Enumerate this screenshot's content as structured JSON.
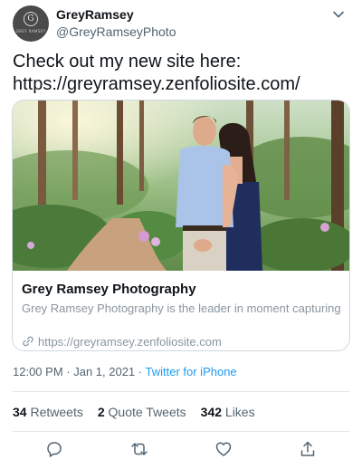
{
  "author": {
    "display_name": "GreyRamsey",
    "handle": "@GreyRamseyPhoto",
    "avatar_letter": "G",
    "avatar_caption": "GREY RAMSEY"
  },
  "tweet": {
    "text_line1": "Check out my new site here:",
    "text_line2": "https://greyramsey.zenfoliosite.com/"
  },
  "card": {
    "image_description": "engaged-couple-in-wooded-garden-path",
    "title": "Grey Ramsey Photography",
    "description": "Grey Ramsey Photography is the leader in moment capturing",
    "link": "https://greyramsey.zenfoliosite.com"
  },
  "meta": {
    "time": "12:00 PM",
    "separator1": " · ",
    "date": "Jan 1, 2021",
    "separator2": " · ",
    "source": "Twitter for iPhone"
  },
  "stats": {
    "retweets_count": "34",
    "retweets_label": "Retweets",
    "quote_count": "2",
    "quote_label": "Quote Tweets",
    "likes_count": "342",
    "likes_label": "Likes"
  },
  "actions": [
    "reply-icon",
    "retweet-icon",
    "like-icon",
    "share-icon"
  ],
  "colors": {
    "link_blue": "#1d9bf0",
    "secondary_text": "#536471",
    "border": "#cfd9de"
  }
}
